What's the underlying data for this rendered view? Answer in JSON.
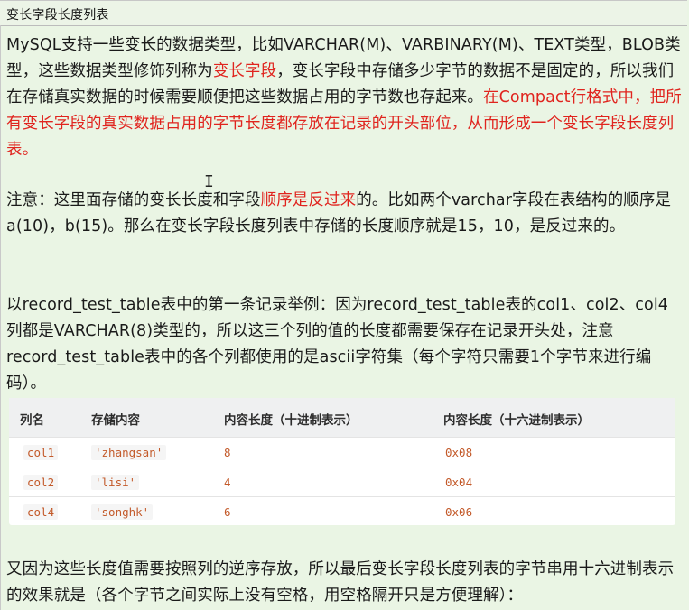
{
  "title": "变长字段长度列表",
  "p1": {
    "t1": "MySQL支持一些变长的数据类型，比如VARCHAR(M)、VARBINARY(M)、TEXT类型，BLOB类型，这些数据类型修饰列称为",
    "t2": "变长字段",
    "t3": "，变长字段中存储多少字节的数据不是固定的，所以我们在存储真实数据的时候需要顺便把这些数据占用的字节数也存起来。",
    "t4": "在Compact行格式中，把所有变长字段的真实数据占用的字节长度都存放在记录的开头部位，从而形成一个变长字段长度列表。"
  },
  "p2": {
    "t1": "注意：这里面存储的变长长度和字段",
    "t2": "顺序是反过来",
    "t3": "的。比如两个varchar字段在表结构的顺序是a(10)，b(15)。那么在变长字段长度列表中存储的长度顺序就是15，10，是反过来的。"
  },
  "p3": "以record_test_table表中的第一条记录举例：因为record_test_table表的col1、col2、col4列都是VARCHAR(8)类型的，所以这三个列的值的长度都需要保存在记录开头处，注意record_test_table表中的各个列都使用的是ascii字符集（每个字符只需要1个字节来进行编码）。",
  "table": {
    "headers": [
      "列名",
      "存储内容",
      "内容长度（十进制表示）",
      "内容长度（十六进制表示）"
    ],
    "rows": [
      [
        "col1",
        "'zhangsan'",
        "8",
        "0x08"
      ],
      [
        "col2",
        "'lisi'",
        "4",
        "0x04"
      ],
      [
        "col4",
        "'songhk'",
        "6",
        "0x06"
      ]
    ]
  },
  "p4": "又因为这些长度值需要按照列的逆序存放，所以最后变长字段长度列表的字节串用十六进制表示的效果就是（各个字节之间实际上没有空格，用空格隔开只是方便理解）：",
  "cursor_glyph": "I"
}
